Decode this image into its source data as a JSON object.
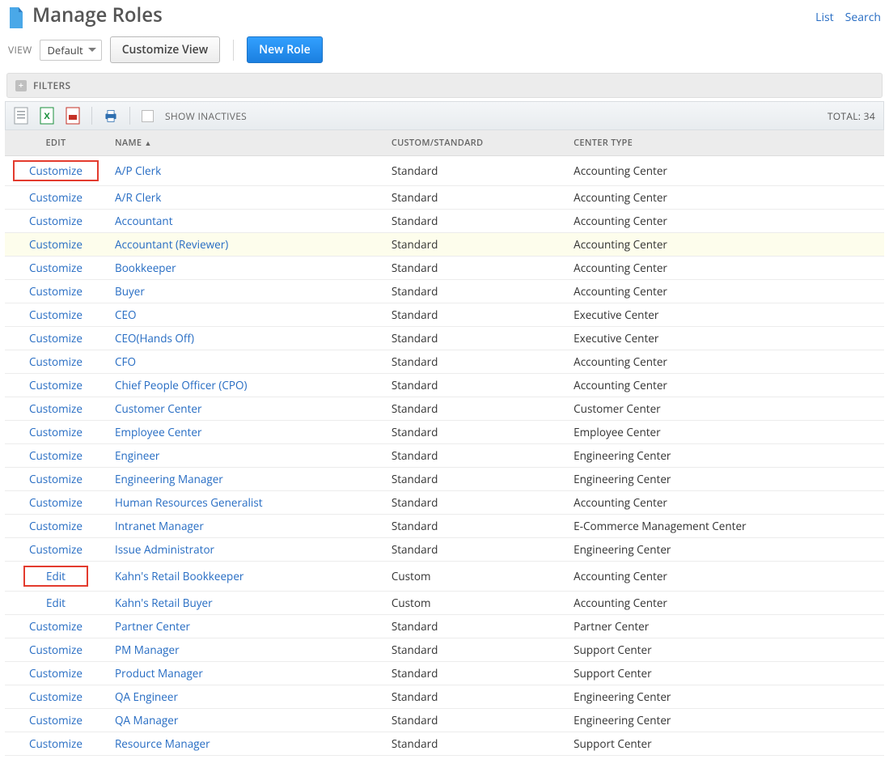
{
  "header": {
    "title": "Manage Roles",
    "links": {
      "list": "List",
      "search": "Search"
    }
  },
  "view": {
    "label": "VIEW",
    "selected": "Default",
    "customize_btn": "Customize View",
    "new_role_btn": "New Role"
  },
  "filters": {
    "label": "FILTERS"
  },
  "toolbar": {
    "show_inactives": "SHOW INACTIVES",
    "total_label": "TOTAL:",
    "total_value": "34"
  },
  "columns": {
    "edit": "EDIT",
    "name": "NAME",
    "type": "CUSTOM/STANDARD",
    "center": "CENTER TYPE"
  },
  "rows": [
    {
      "edit": "Customize",
      "name": "A/P Clerk",
      "type": "Standard",
      "center": "Accounting Center",
      "box": true
    },
    {
      "edit": "Customize",
      "name": "A/R Clerk",
      "type": "Standard",
      "center": "Accounting Center"
    },
    {
      "edit": "Customize",
      "name": "Accountant",
      "type": "Standard",
      "center": "Accounting Center"
    },
    {
      "edit": "Customize",
      "name": "Accountant (Reviewer)",
      "type": "Standard",
      "center": "Accounting Center",
      "highlight": true
    },
    {
      "edit": "Customize",
      "name": "Bookkeeper",
      "type": "Standard",
      "center": "Accounting Center"
    },
    {
      "edit": "Customize",
      "name": "Buyer",
      "type": "Standard",
      "center": "Accounting Center"
    },
    {
      "edit": "Customize",
      "name": "CEO",
      "type": "Standard",
      "center": "Executive Center"
    },
    {
      "edit": "Customize",
      "name": "CEO(Hands Off)",
      "type": "Standard",
      "center": "Executive Center"
    },
    {
      "edit": "Customize",
      "name": "CFO",
      "type": "Standard",
      "center": "Accounting Center"
    },
    {
      "edit": "Customize",
      "name": "Chief People Officer (CPO)",
      "type": "Standard",
      "center": "Accounting Center"
    },
    {
      "edit": "Customize",
      "name": "Customer Center",
      "type": "Standard",
      "center": "Customer Center"
    },
    {
      "edit": "Customize",
      "name": "Employee Center",
      "type": "Standard",
      "center": "Employee Center"
    },
    {
      "edit": "Customize",
      "name": "Engineer",
      "type": "Standard",
      "center": "Engineering Center"
    },
    {
      "edit": "Customize",
      "name": "Engineering Manager",
      "type": "Standard",
      "center": "Engineering Center"
    },
    {
      "edit": "Customize",
      "name": "Human Resources Generalist",
      "type": "Standard",
      "center": "Accounting Center"
    },
    {
      "edit": "Customize",
      "name": "Intranet Manager",
      "type": "Standard",
      "center": "E-Commerce Management Center"
    },
    {
      "edit": "Customize",
      "name": "Issue Administrator",
      "type": "Standard",
      "center": "Engineering Center"
    },
    {
      "edit": "Edit",
      "name": "Kahn's Retail Bookkeeper",
      "type": "Custom",
      "center": "Accounting Center",
      "box": true
    },
    {
      "edit": "Edit",
      "name": "Kahn's Retail Buyer",
      "type": "Custom",
      "center": "Accounting Center"
    },
    {
      "edit": "Customize",
      "name": "Partner Center",
      "type": "Standard",
      "center": "Partner Center"
    },
    {
      "edit": "Customize",
      "name": "PM Manager",
      "type": "Standard",
      "center": "Support Center"
    },
    {
      "edit": "Customize",
      "name": "Product Manager",
      "type": "Standard",
      "center": "Support Center"
    },
    {
      "edit": "Customize",
      "name": "QA Engineer",
      "type": "Standard",
      "center": "Engineering Center"
    },
    {
      "edit": "Customize",
      "name": "QA Manager",
      "type": "Standard",
      "center": "Engineering Center"
    },
    {
      "edit": "Customize",
      "name": "Resource Manager",
      "type": "Standard",
      "center": "Support Center"
    }
  ]
}
